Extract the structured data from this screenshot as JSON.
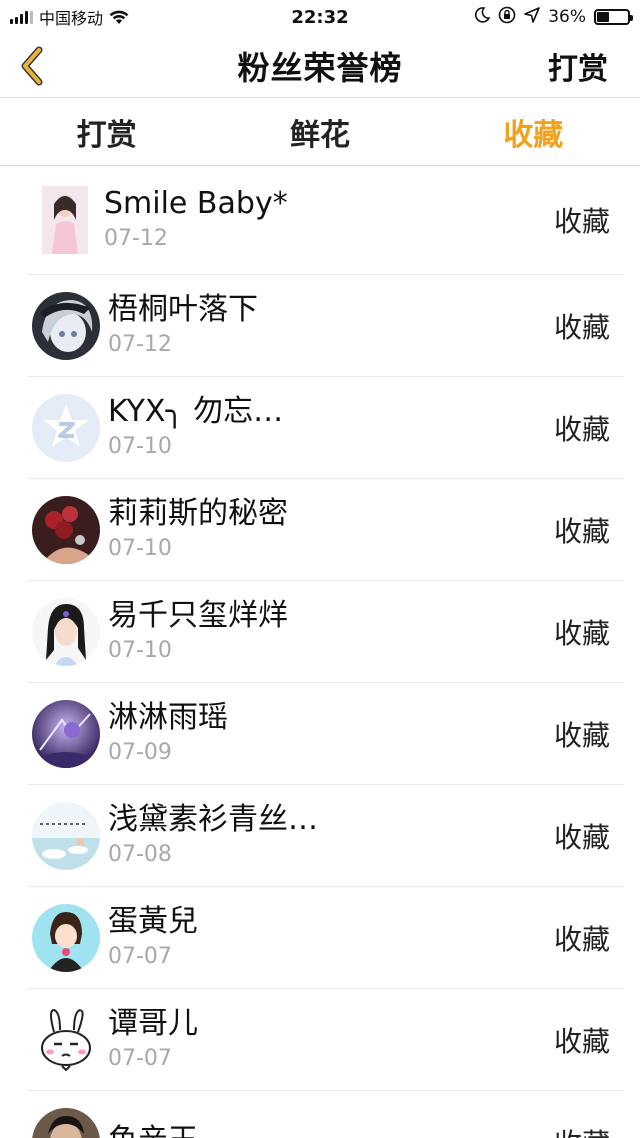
{
  "status_bar": {
    "carrier": "中国移动",
    "time": "22:32",
    "battery": "36%",
    "battery_level": 0.36
  },
  "nav": {
    "title": "粉丝荣誉榜",
    "right": "打赏"
  },
  "tabs": [
    {
      "label": "打赏",
      "active": false
    },
    {
      "label": "鲜花",
      "active": false
    },
    {
      "label": "收藏",
      "active": true
    }
  ],
  "colors": {
    "accent": "#f0a21e",
    "back_icon": "#e8b23a"
  },
  "list": [
    {
      "name": "Smile Baby*",
      "date": "07-12",
      "action": "收藏",
      "avatar": "girl-photo"
    },
    {
      "name": "梧桐叶落下",
      "date": "07-12",
      "action": "收藏",
      "avatar": "anime-girl"
    },
    {
      "name": "KYX╮ 勿忘…",
      "date": "07-10",
      "action": "收藏",
      "avatar": "qq-logo"
    },
    {
      "name": "莉莉斯的秘密",
      "date": "07-10",
      "action": "收藏",
      "avatar": "roses"
    },
    {
      "name": "易千只玺烊烊",
      "date": "07-10",
      "action": "收藏",
      "avatar": "doll-girl"
    },
    {
      "name": "淋淋雨瑶",
      "date": "07-09",
      "action": "收藏",
      "avatar": "purple-art"
    },
    {
      "name": "浅黛素衫青丝…",
      "date": "07-08",
      "action": "收藏",
      "avatar": "sky-text"
    },
    {
      "name": "蛋黃兒",
      "date": "07-07",
      "action": "收藏",
      "avatar": "cartoon-girl"
    },
    {
      "name": "谭哥儿",
      "date": "07-07",
      "action": "收藏",
      "avatar": "bunny"
    },
    {
      "name": "鱼亲王",
      "date": "",
      "action": "收藏",
      "avatar": "man-photo"
    }
  ]
}
